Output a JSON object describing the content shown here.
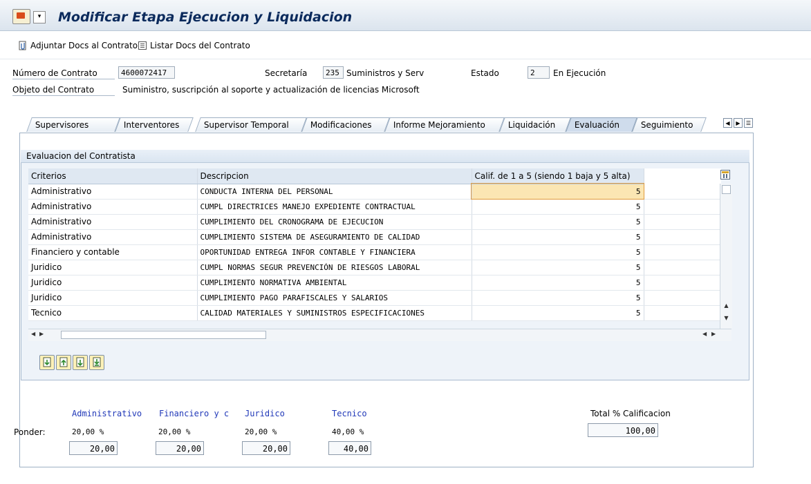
{
  "window": {
    "title": "Modificar Etapa Ejecucion y Liquidacion"
  },
  "toolbar": {
    "attach_label": "Adjuntar Docs al Contrato",
    "list_label": "Listar Docs del Contrato"
  },
  "header": {
    "contract_no_label": "Número de Contrato",
    "contract_no": "4600072417",
    "secretaria_label": "Secretaría",
    "secretaria_code": "235",
    "secretaria_text": "Suministros y Serv",
    "estado_label": "Estado",
    "estado_code": "2",
    "estado_text": "En Ejecución",
    "objeto_label": "Objeto del Contrato",
    "objeto_text": "Suministro, suscripción al soporte y actualización de licencias Microsoft"
  },
  "tabs": [
    {
      "label": "Supervisores"
    },
    {
      "label": "Interventores"
    },
    {
      "label": "Supervisor Temporal"
    },
    {
      "label": "Modificaciones"
    },
    {
      "label": "Informe Mejoramiento"
    },
    {
      "label": "Liquidación"
    },
    {
      "label": "Evaluación"
    },
    {
      "label": "Seguimiento"
    }
  ],
  "active_tab": "Evaluación",
  "evaluation": {
    "group_title": "Evaluacion del Contratista",
    "columns": [
      "Criterios",
      "Descripcion",
      "Calif. de 1 a 5 (siendo 1 baja y 5 alta)"
    ],
    "rows": [
      {
        "criterio": "Administrativo",
        "descripcion": "CONDUCTA INTERNA DEL PERSONAL",
        "calif": "5"
      },
      {
        "criterio": "Administrativo",
        "descripcion": "CUMPL DIRECTRICES MANEJO EXPEDIENTE CONTRACTUAL",
        "calif": "5"
      },
      {
        "criterio": "Administrativo",
        "descripcion": "CUMPLIMIENTO DEL CRONOGRAMA DE EJECUCION",
        "calif": "5"
      },
      {
        "criterio": "Administrativo",
        "descripcion": "CUMPLIMIENTO SISTEMA DE ASEGURAMIENTO DE CALIDAD",
        "calif": "5"
      },
      {
        "criterio": "Financiero y contable",
        "descripcion": "OPORTUNIDAD ENTREGA INFOR CONTABLE Y FINANCIERA",
        "calif": "5"
      },
      {
        "criterio": "Juridico",
        "descripcion": "CUMPL NORMAS SEGUR PREVENCIÓN DE RIESGOS LABORAL",
        "calif": "5"
      },
      {
        "criterio": "Juridico",
        "descripcion": "CUMPLIMIENTO NORMATIVA AMBIENTAL",
        "calif": "5"
      },
      {
        "criterio": "Juridico",
        "descripcion": "CUMPLIMIENTO PAGO PARAFISCALES Y SALARIOS",
        "calif": "5"
      },
      {
        "criterio": "Tecnico",
        "descripcion": "CALIDAD MATERIALES Y SUMINISTROS ESPECIFICACIONES",
        "calif": "5"
      }
    ]
  },
  "ponderacion": {
    "label": "Ponder:",
    "total_label": "Total % Calificacion",
    "total_value": "100,00",
    "items": [
      {
        "name": "Administrativo",
        "pct": "20,00 %",
        "value": "20,00"
      },
      {
        "name": "Financiero y c",
        "pct": "20,00 %",
        "value": "20,00"
      },
      {
        "name": "Juridico",
        "pct": "20,00 %",
        "value": "20,00"
      },
      {
        "name": "Tecnico",
        "pct": "40,00 %",
        "value": "40,00"
      }
    ]
  },
  "icons": [
    "app-icon",
    "menu-icon",
    "attach-icon",
    "list-icon",
    "config-icon",
    "scroll-up-icon",
    "scroll-down-icon",
    "scroll-left-icon",
    "scroll-right-icon",
    "tab-nav-left-icon",
    "tab-nav-right-icon",
    "tab-list-icon",
    "row-action-icons"
  ]
}
